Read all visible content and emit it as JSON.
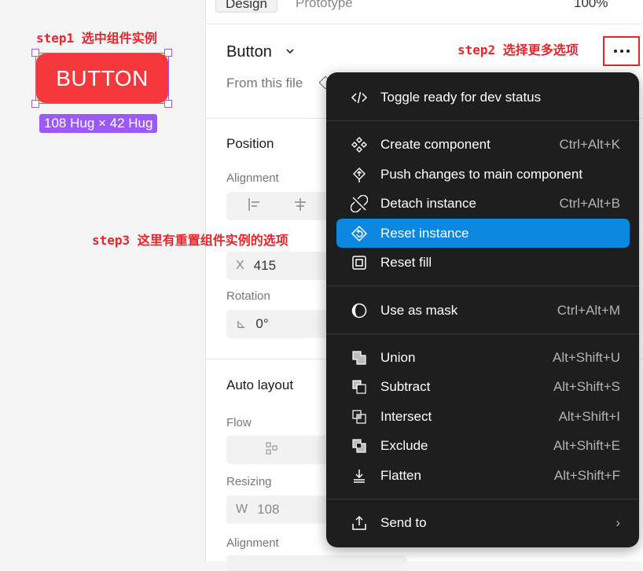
{
  "annotations": {
    "step1": "step1 选中组件实例",
    "step2": "step2 选择更多选项",
    "step3": "step3 这里有重置组件实例的选项"
  },
  "canvas": {
    "button_label": "BUTTON",
    "size_badge": "108 Hug × 42 Hug"
  },
  "panel": {
    "tabs": [
      "Design",
      "Prototype"
    ],
    "zoom": "100%",
    "component_name": "Button",
    "from_file": "From this file",
    "position_title": "Position",
    "alignment_label": "Alignment",
    "x_prefix": "X",
    "x_value": "415",
    "rotation_label": "Rotation",
    "rotation_prefix": "⊾",
    "rotation_value": "0°",
    "auto_layout_title": "Auto layout",
    "flow_label": "Flow",
    "resizing_label": "Resizing",
    "w_prefix": "W",
    "w_value": "108",
    "alignment2_label": "Alignment"
  },
  "menu": {
    "items": [
      {
        "label": "Toggle ready for dev status",
        "shortcut": "",
        "icon": "code-icon"
      },
      {
        "label": "Create component",
        "shortcut": "Ctrl+Alt+K",
        "icon": "component-icon"
      },
      {
        "label": "Push changes to main component",
        "shortcut": "",
        "icon": "push-changes-icon"
      },
      {
        "label": "Detach instance",
        "shortcut": "Ctrl+Alt+B",
        "icon": "detach-icon"
      },
      {
        "label": "Reset instance",
        "shortcut": "",
        "icon": "reset-instance-icon"
      },
      {
        "label": "Reset fill",
        "shortcut": "",
        "icon": "reset-fill-icon"
      },
      {
        "label": "Use as mask",
        "shortcut": "Ctrl+Alt+M",
        "icon": "mask-icon"
      },
      {
        "label": "Union",
        "shortcut": "Alt+Shift+U",
        "icon": "union-icon"
      },
      {
        "label": "Subtract",
        "shortcut": "Alt+Shift+S",
        "icon": "subtract-icon"
      },
      {
        "label": "Intersect",
        "shortcut": "Alt+Shift+I",
        "icon": "intersect-icon"
      },
      {
        "label": "Exclude",
        "shortcut": "Alt+Shift+E",
        "icon": "exclude-icon"
      },
      {
        "label": "Flatten",
        "shortcut": "Alt+Shift+F",
        "icon": "flatten-icon"
      },
      {
        "label": "Send to",
        "shortcut": "›",
        "icon": "send-to-icon"
      }
    ]
  },
  "colors": {
    "annotation": "#e8252b",
    "selection": "#9b59f5",
    "button_fill": "#f5383b",
    "menu_bg": "#1e1e1e",
    "menu_active": "#0d88e0"
  }
}
